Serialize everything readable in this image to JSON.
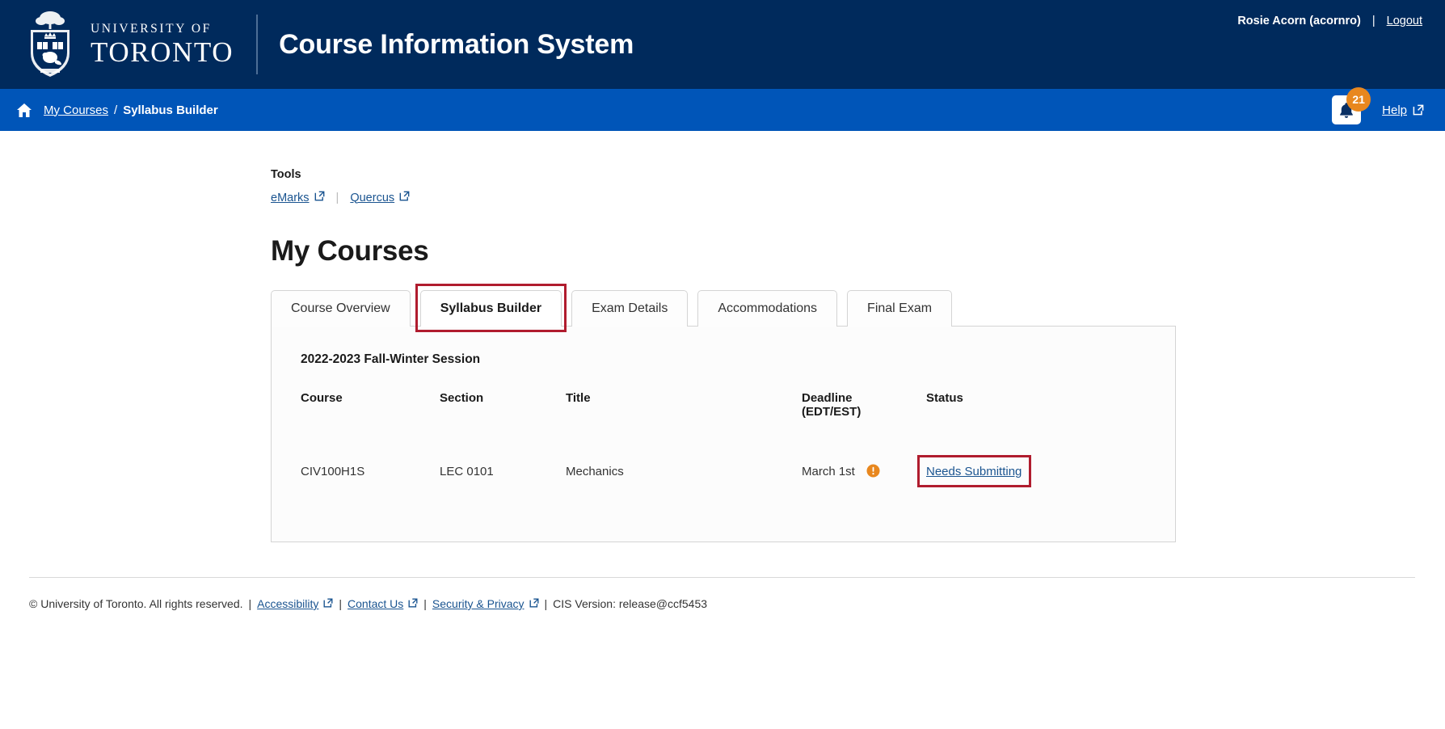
{
  "header": {
    "university_line1": "UNIVERSITY OF",
    "university_line2": "TORONTO",
    "app_title": "Course Information System",
    "user_name": "Rosie Acorn (acornro)",
    "separator": "|",
    "logout_label": "Logout"
  },
  "navbar": {
    "home_icon": "home-icon",
    "breadcrumb_root": "My Courses",
    "breadcrumb_separator": "/",
    "breadcrumb_current": "Syllabus Builder",
    "notification_count": "21",
    "bell_icon": "bell-icon",
    "help_label": "Help",
    "external_icon": "external-link-icon"
  },
  "tools": {
    "heading": "Tools",
    "links": [
      {
        "label": "eMarks"
      },
      {
        "label": "Quercus"
      }
    ],
    "divider": "|"
  },
  "main": {
    "page_title": "My Courses",
    "tabs": [
      {
        "label": "Course Overview",
        "active": false
      },
      {
        "label": "Syllabus Builder",
        "active": true
      },
      {
        "label": "Exam Details",
        "active": false
      },
      {
        "label": "Accommodations",
        "active": false
      },
      {
        "label": "Final Exam",
        "active": false
      }
    ],
    "session_label": "2022-2023 Fall-Winter Session",
    "table": {
      "columns": [
        "Course",
        "Section",
        "Title",
        "Deadline (EDT/EST)",
        "Status"
      ],
      "deadline_header_line1": "Deadline",
      "deadline_header_line2": "(EDT/EST)",
      "rows": [
        {
          "course": "CIV100H1S",
          "section": "LEC 0101",
          "title": "Mechanics",
          "deadline": "March 1st",
          "deadline_warning": true,
          "status": "Needs Submitting"
        }
      ]
    }
  },
  "footer": {
    "copyright": "© University of Toronto. All rights reserved.",
    "pipe": "|",
    "links": [
      {
        "label": "Accessibility"
      },
      {
        "label": "Contact Us"
      },
      {
        "label": "Security & Privacy"
      }
    ],
    "version": "CIS Version: release@ccf5453"
  },
  "colors": {
    "header_navy": "#002a5c",
    "nav_blue": "#0055b8",
    "link_blue": "#1a5490",
    "badge_orange": "#e8871e",
    "annotation_red": "#b01c2e"
  }
}
